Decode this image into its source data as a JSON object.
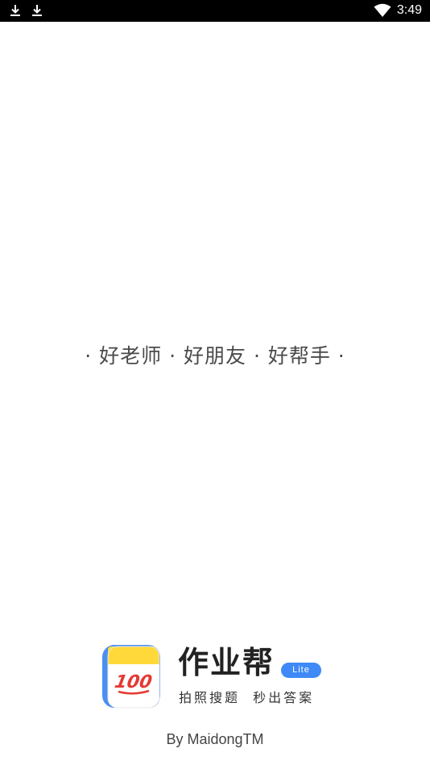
{
  "status_bar": {
    "time": "3:49",
    "left_icons": [
      "download-icon",
      "download-icon"
    ],
    "right_icons": [
      "wifi-icon"
    ]
  },
  "splash": {
    "slogan": "· 好老师 · 好朋友 · 好帮手 ·"
  },
  "brand": {
    "app_name": "作业帮",
    "badge": "Lite",
    "tagline": "拍照搜题  秒出答案",
    "icon_text": "100",
    "colors": {
      "icon_blue": "#4a90f0",
      "icon_yellow": "#ffd93a",
      "badge_blue": "#3f8af6"
    }
  },
  "footer": {
    "credit": "By MaidongTM"
  }
}
